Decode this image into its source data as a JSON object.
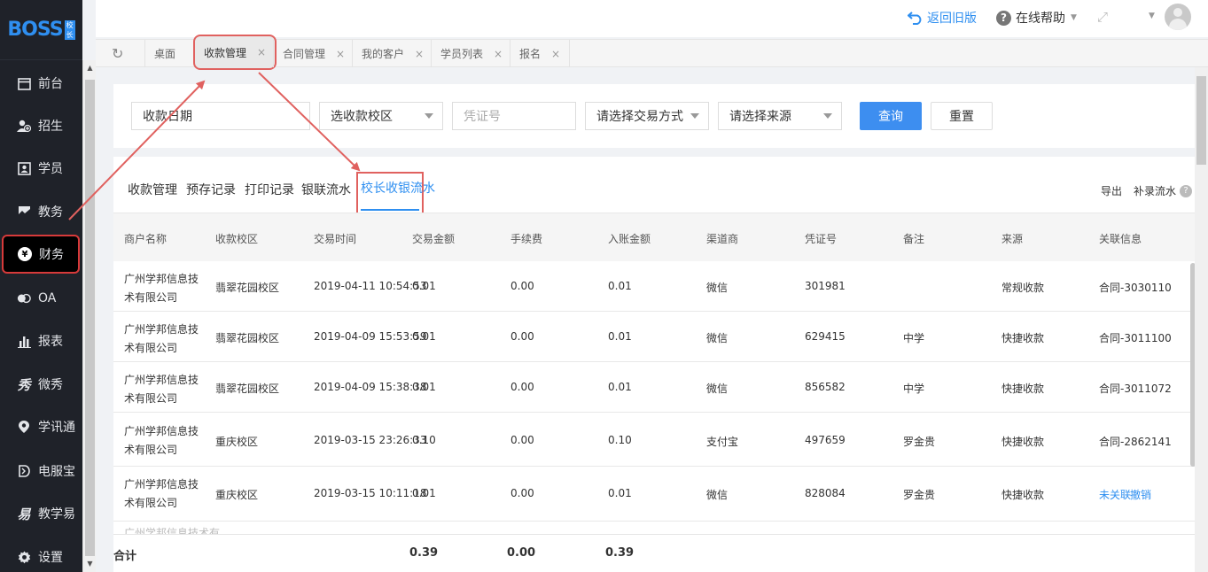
{
  "brand": {
    "logo_text": "BOSS",
    "logo_badge": "校长"
  },
  "sidebar": {
    "items": [
      {
        "label": "前台",
        "icon": "calendar-icon"
      },
      {
        "label": "招生",
        "icon": "add-user-icon"
      },
      {
        "label": "学员",
        "icon": "id-card-icon"
      },
      {
        "label": "教务",
        "icon": "book-icon"
      },
      {
        "label": "财务",
        "icon": "yen-icon",
        "active": true
      },
      {
        "label": "OA",
        "icon": "chat-icon"
      },
      {
        "label": "报表",
        "icon": "bar-chart-icon"
      },
      {
        "label": "微秀",
        "icon": "xiu-icon"
      },
      {
        "label": "学讯通",
        "icon": "location-icon"
      },
      {
        "label": "电服宝",
        "icon": "phone-icon"
      },
      {
        "label": "教学易",
        "icon": "edu-icon"
      },
      {
        "label": "设置",
        "icon": "gear-icon"
      }
    ]
  },
  "header": {
    "back_label": "返回旧版",
    "help_label": "在线帮助"
  },
  "page_tabs": [
    {
      "label": "桌面",
      "closable": false
    },
    {
      "label": "收款管理",
      "closable": true,
      "active": true
    },
    {
      "label": "合同管理",
      "closable": true
    },
    {
      "label": "我的客户",
      "closable": true
    },
    {
      "label": "学员列表",
      "closable": true
    },
    {
      "label": "报名",
      "closable": true
    }
  ],
  "filters": {
    "date_placeholder": "收款日期",
    "campus_placeholder": "选收款校区",
    "voucher_placeholder": "凭证号",
    "paytype_placeholder": "请选择交易方式",
    "source_placeholder": "请选择来源",
    "query_label": "查询",
    "reset_label": "重置"
  },
  "sub_tabs": [
    {
      "label": "收款管理"
    },
    {
      "label": "预存记录"
    },
    {
      "label": "打印记录"
    },
    {
      "label": "银联流水"
    },
    {
      "label": "校长收银流水",
      "active": true
    }
  ],
  "actions": {
    "export_label": "导出",
    "supplement_label": "补录流水"
  },
  "table": {
    "columns": [
      "商户名称",
      "收款校区",
      "交易时间",
      "交易金额",
      "手续费",
      "入账金额",
      "渠道商",
      "凭证号",
      "备注",
      "来源",
      "关联信息"
    ],
    "rows": [
      {
        "merchant": "广州学邦信息技术有限公司",
        "campus": "翡翠花园校区",
        "time": "2019-04-11 10:54:53",
        "amount": "0.01",
        "fee": "0.00",
        "net": "0.01",
        "channel": "微信",
        "voucher": "301981",
        "note": "",
        "source": "常规收款",
        "link": "合同-3030110"
      },
      {
        "merchant": "广州学邦信息技术有限公司",
        "campus": "翡翠花园校区",
        "time": "2019-04-09 15:53:59",
        "amount": "0.01",
        "fee": "0.00",
        "net": "0.01",
        "channel": "微信",
        "voucher": "629415",
        "note": "中学",
        "source": "快捷收款",
        "link": "合同-3011100"
      },
      {
        "merchant": "广州学邦信息技术有限公司",
        "campus": "翡翠花园校区",
        "time": "2019-04-09 15:38:38",
        "amount": "0.01",
        "fee": "0.00",
        "net": "0.01",
        "channel": "微信",
        "voucher": "856582",
        "note": "中学",
        "source": "快捷收款",
        "link": "合同-3011072"
      },
      {
        "merchant": "广州学邦信息技术有限公司",
        "campus": "重庆校区",
        "time": "2019-03-15 23:26:33",
        "amount": "0.10",
        "fee": "0.00",
        "net": "0.10",
        "channel": "支付宝",
        "voucher": "497659",
        "note": "罗金贵",
        "source": "快捷收款",
        "link": "合同-2862141"
      },
      {
        "merchant": "广州学邦信息技术有限公司",
        "campus": "重庆校区",
        "time": "2019-03-15 10:11:18",
        "amount": "0.01",
        "fee": "0.00",
        "net": "0.01",
        "channel": "微信",
        "voucher": "828084",
        "note": "罗金贵",
        "source": "快捷收款",
        "link_unlinked": "未关联",
        "link_revoke": "撤销"
      }
    ],
    "partial_row_text": "广州学邦信息技术有",
    "footer": {
      "label": "合计",
      "amount": "0.39",
      "fee": "0.00",
      "net": "0.39"
    }
  },
  "colors": {
    "accent": "#2f8ff0",
    "annotation": "#e0615f",
    "sidebar_bg": "#1f2229"
  }
}
